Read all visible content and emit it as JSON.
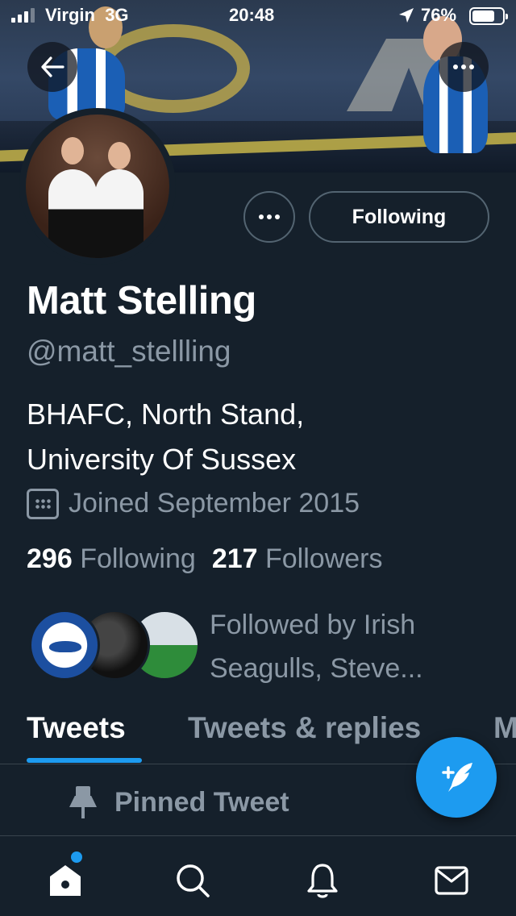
{
  "status_bar": {
    "carrier": "Virgin",
    "network": "3G",
    "time": "20:48",
    "battery_percent": "76%",
    "battery_level": 0.76
  },
  "profile": {
    "name": "Matt Stelling",
    "handle": "@matt_stellling",
    "bio_line1": "BHAFC, North Stand,",
    "bio_line2": "University Of Sussex",
    "joined": "Joined September 2015",
    "following_count": "296",
    "following_label": "Following",
    "followers_count": "217",
    "followers_label": "Followers",
    "followed_by_line1": "Followed by Irish",
    "followed_by_line2": "Seagulls, Steve..."
  },
  "actions": {
    "following_button": "Following"
  },
  "tabs": [
    {
      "label": "Tweets",
      "active": true
    },
    {
      "label": "Tweets & replies",
      "active": false
    },
    {
      "label": "M",
      "active": false
    }
  ],
  "pinned": {
    "label": "Pinned Tweet"
  },
  "colors": {
    "background": "#15202b",
    "accent": "#1d9bf0",
    "secondary_text": "#8b98a5",
    "border": "#38444d"
  },
  "icons": {
    "back": "arrow-left-icon",
    "more": "more-dots-icon",
    "calendar": "calendar-icon",
    "pin": "pin-icon",
    "compose": "compose-tweet-icon",
    "home": "home-icon",
    "search": "search-icon",
    "notifications": "bell-icon",
    "messages": "mail-icon"
  }
}
